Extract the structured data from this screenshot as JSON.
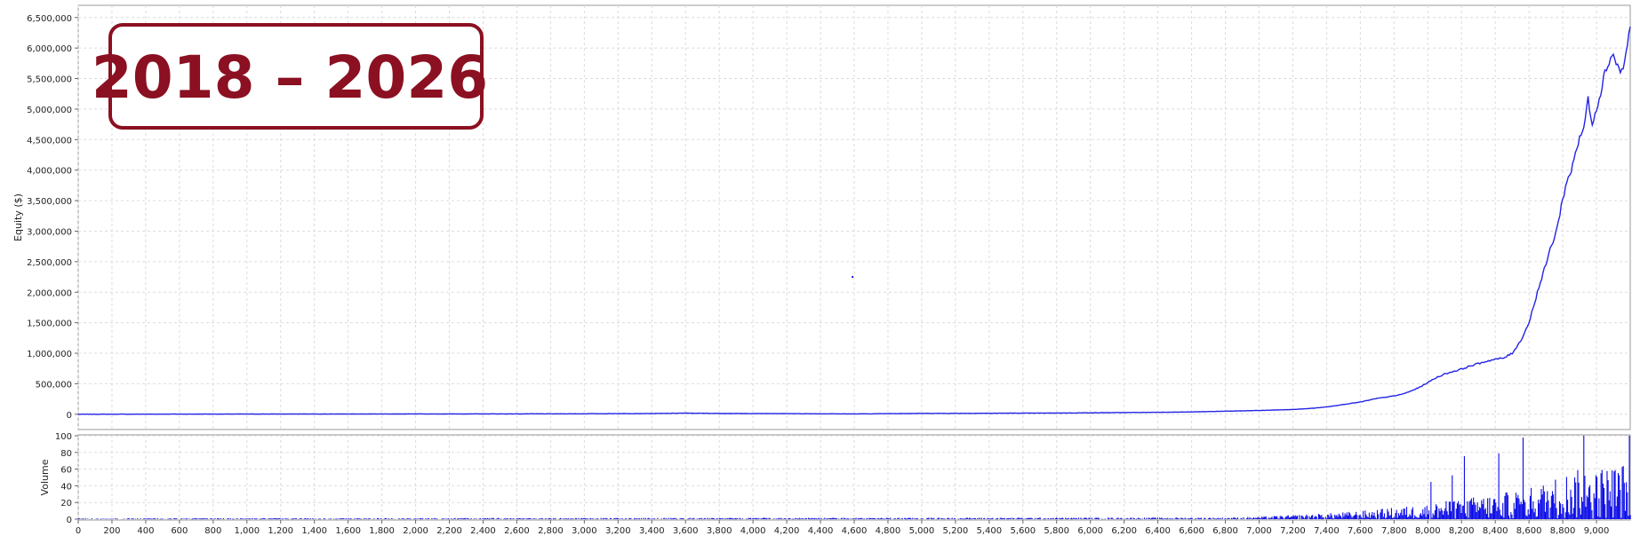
{
  "chart_data": [
    {
      "type": "line",
      "title": "",
      "xlabel": "",
      "ylabel": "Equity ($)",
      "xlim": [
        0,
        9200
      ],
      "ylim": [
        -250000,
        6700000
      ],
      "grid": true,
      "legend": "none",
      "line_color": "#2323e6",
      "y_ticks": [
        0,
        500000,
        1000000,
        1500000,
        2000000,
        2500000,
        3000000,
        3500000,
        4000000,
        4500000,
        5000000,
        5500000,
        6000000,
        6500000
      ],
      "y_tick_labels": [
        "0",
        "500,000",
        "1,000,000",
        "1,500,000",
        "2,000,000",
        "2,500,000",
        "3,000,000",
        "3,500,000",
        "4,000,000",
        "4,500,000",
        "5,000,000",
        "5,500,000",
        "6,000,000",
        "6,500,000"
      ],
      "annotation": {
        "text": "2018 – 2026",
        "color": "#8b1021"
      },
      "series": [
        {
          "x": [
            0,
            500,
            1000,
            1500,
            2000,
            2500,
            3000,
            3400,
            3600,
            3700,
            3900,
            4200,
            4600,
            5000,
            5400,
            5800,
            6200,
            6400,
            6600,
            6800,
            7000,
            7100,
            7200,
            7300,
            7400,
            7500,
            7600,
            7700,
            7800,
            7850,
            7900,
            7950,
            8000,
            8050,
            8100,
            8150,
            8200,
            8250,
            8300,
            8350,
            8400,
            8450,
            8500,
            8550,
            8600,
            8650,
            8700,
            8725,
            8750,
            8775,
            8800,
            8825,
            8850,
            8875,
            8900,
            8925,
            8950,
            8975,
            9000,
            9025,
            9050,
            9075,
            9100,
            9125,
            9150,
            9175,
            9200
          ],
          "y": [
            0,
            2000,
            3000,
            4000,
            5000,
            6000,
            8000,
            12000,
            18000,
            16000,
            12000,
            10000,
            6000,
            14000,
            16000,
            20000,
            28000,
            32000,
            38000,
            50000,
            62000,
            70000,
            78000,
            95000,
            120000,
            160000,
            200000,
            260000,
            300000,
            330000,
            380000,
            440000,
            520000,
            600000,
            660000,
            700000,
            740000,
            790000,
            830000,
            870000,
            900000,
            920000,
            1000000,
            1200000,
            1500000,
            2000000,
            2450000,
            2700000,
            2900000,
            3150000,
            3550000,
            3800000,
            4000000,
            4300000,
            4500000,
            4700000,
            5150000,
            4800000,
            5000000,
            5300000,
            5600000,
            5800000,
            5900000,
            5700000,
            5600000,
            5900000,
            6350000
          ]
        }
      ],
      "outlier_points": [
        {
          "x": 4590,
          "y": 2250000
        }
      ]
    },
    {
      "type": "bar",
      "title": "",
      "xlabel": "",
      "ylabel": "Volume",
      "xlim": [
        0,
        9200
      ],
      "ylim": [
        0,
        100
      ],
      "grid": true,
      "legend": "none",
      "bar_color": "#0a0ae8",
      "x_ticks": [
        0,
        200,
        400,
        600,
        800,
        1000,
        1200,
        1400,
        1600,
        1800,
        2000,
        2200,
        2400,
        2600,
        2800,
        3000,
        3200,
        3400,
        3600,
        3800,
        4000,
        4200,
        4400,
        4600,
        4800,
        5000,
        5200,
        5400,
        5600,
        5800,
        6000,
        6200,
        6400,
        6600,
        6800,
        7000,
        7200,
        7400,
        7600,
        7800,
        8000,
        8200,
        8400,
        8600,
        8800,
        9000
      ],
      "x_tick_labels": [
        "0",
        "200",
        "400",
        "600",
        "800",
        "1,000",
        "1,200",
        "1,400",
        "1,600",
        "1,800",
        "2,000",
        "2,200",
        "2,400",
        "2,600",
        "2,800",
        "3,000",
        "3,200",
        "3,400",
        "3,600",
        "3,800",
        "4,000",
        "4,200",
        "4,400",
        "4,600",
        "4,800",
        "5,000",
        "5,200",
        "5,400",
        "5,600",
        "5,800",
        "6,000",
        "6,200",
        "6,400",
        "6,600",
        "6,800",
        "7,000",
        "7,200",
        "7,400",
        "7,600",
        "7,800",
        "8,000",
        "8,200",
        "8,400",
        "8,600",
        "8,800",
        "9,000"
      ],
      "y_ticks": [
        0,
        20,
        40,
        60,
        80,
        100
      ],
      "y_tick_labels": [
        "0",
        "20",
        "40",
        "60",
        "80",
        "100"
      ],
      "volume_envelope": {
        "x": [
          0,
          6800,
          7000,
          7200,
          7400,
          7600,
          7800,
          8000,
          8200,
          8400,
          8600,
          8700,
          8800,
          8900,
          9000,
          9100,
          9200
        ],
        "y": [
          1,
          2,
          3,
          5,
          7,
          10,
          14,
          18,
          25,
          30,
          38,
          45,
          55,
          60,
          62,
          65,
          70
        ]
      }
    }
  ]
}
